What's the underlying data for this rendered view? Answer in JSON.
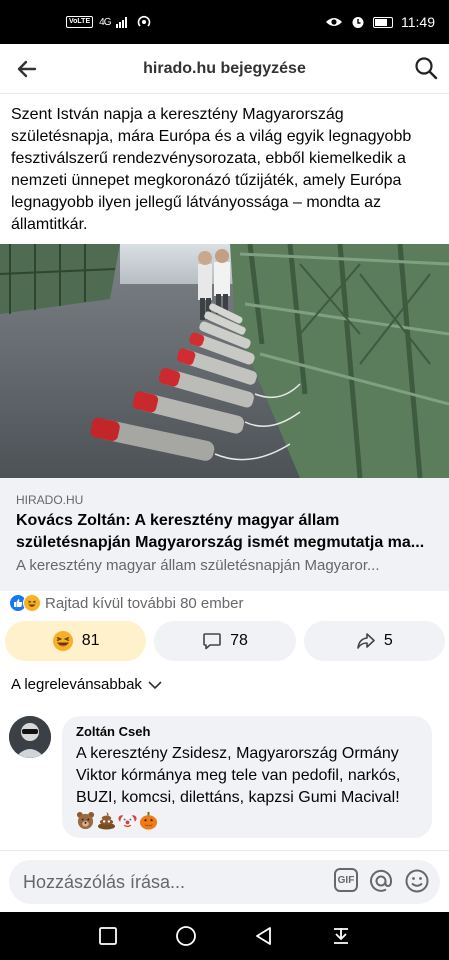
{
  "status": {
    "time": "11:49",
    "volte": "VoLTE",
    "network": "4G"
  },
  "header": {
    "title": "hirado.hu bejegyzése"
  },
  "post": {
    "text": "Szent István napja a keresztény Magyarország születésnapja, mára Európa és a világ egyik legnagyobb fesztiválszerű rendezvénysorozata, ebből kiemelkedik a nemzeti ünnepet megkoronázó tűzijáték, amely Európa legnagyobb ilyen jellegű látványossága – mondta az államtitkár."
  },
  "link": {
    "domain": "HIRADO.HU",
    "title_line1": "Kovács Zoltán: A keresztény magyar állam",
    "title_line2": "születésnapján Magyarország ismét megmutatja ma...",
    "description": "A keresztény magyar állam születésnapján Magyaror..."
  },
  "reactions": {
    "summary": "Rajtad kívül további 80 ember"
  },
  "actions": {
    "react_count": "81",
    "comment_count": "78",
    "share_count": "5"
  },
  "sort": {
    "label": "A legrelevánsabbak"
  },
  "comment": {
    "author": "Zoltán Cseh",
    "text": "A keresztény Zsidesz, Magyarország Ormány Viktor kórmánya meg tele van pedofil, narkós, BUZI, komcsi, dilettáns, kapzsi Gumi Macival!",
    "emojis": [
      "bear-emoji",
      "poop-emoji",
      "clown-emoji",
      "pumpkin-emoji"
    ]
  },
  "composer": {
    "placeholder": "Hozzászólás írása...",
    "gif_label": "GIF"
  },
  "colors": {
    "accent": "#1877f2",
    "haha": "#f7b125",
    "active_react_bg": "#fff1cc"
  }
}
